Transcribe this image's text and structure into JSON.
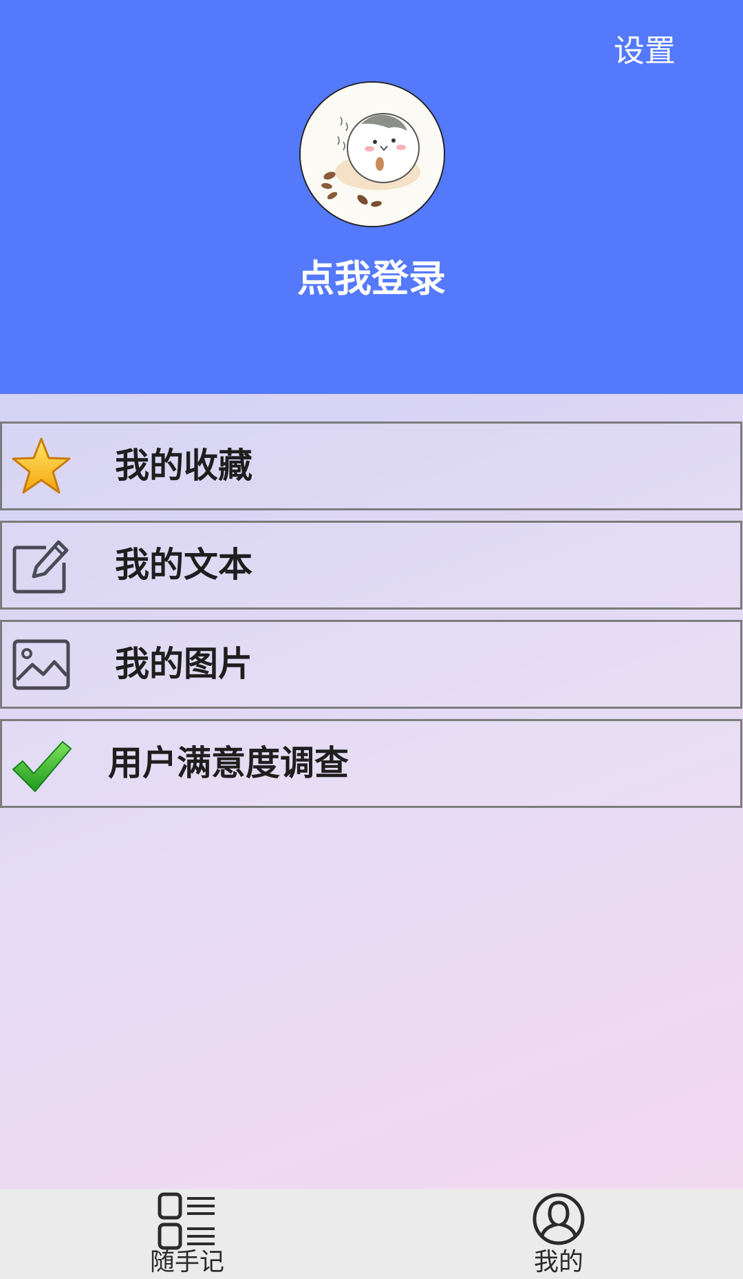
{
  "header": {
    "settings_label": "设置",
    "login_label": "点我登录",
    "background_color": "#5479fb"
  },
  "menu": {
    "items": [
      {
        "label": "我的收藏",
        "icon": "star-icon"
      },
      {
        "label": "我的文本",
        "icon": "edit-icon"
      },
      {
        "label": "我的图片",
        "icon": "image-icon"
      },
      {
        "label": "用户满意度调查",
        "icon": "checkmark-icon"
      }
    ]
  },
  "tabbar": {
    "tabs": [
      {
        "label": "随手记",
        "icon": "list-icon"
      },
      {
        "label": "我的",
        "icon": "profile-icon"
      }
    ]
  }
}
